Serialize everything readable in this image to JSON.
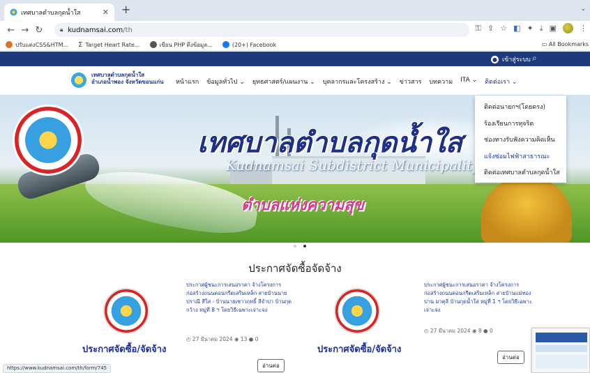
{
  "browser": {
    "tab_title": "เทศบาลตำบลกุดน้ำใส",
    "url_domain": "kudnamsai.com",
    "url_path": "/th",
    "bookmarks": [
      {
        "label": "ปรับแต่งCSS&HTM...",
        "color": "#e0702a"
      },
      {
        "label": "Target Heart Rate...",
        "color": "#444444"
      },
      {
        "label": "เขียน PHP ดึงข้อมูล...",
        "color": "#555555"
      },
      {
        "label": "(20+) Facebook",
        "color": "#1877f2"
      }
    ],
    "all_bookmarks": "All Bookmarks",
    "status_url": "https://www.kudnamsai.com/th/form/745"
  },
  "topbar": {
    "login": "เข้าสู่ระบบ"
  },
  "brand": {
    "line1": "เทศบาลตำบลกุดน้ำใส",
    "line2": "อำเภอน้ำพอง จังหวัดขอนแก่น"
  },
  "menu": [
    {
      "label": "หน้าแรก",
      "active": false
    },
    {
      "label": "ข้อมูลทั่วไป ⌄",
      "active": false
    },
    {
      "label": "ยุทธศาสตร์/แผนงาน ⌄",
      "active": false
    },
    {
      "label": "บุคลากรและโครงสร้าง ⌄",
      "active": false
    },
    {
      "label": "ข่าวสาร",
      "active": false
    },
    {
      "label": "บทความ",
      "active": false
    },
    {
      "label": "ITA ⌄",
      "active": false
    },
    {
      "label": "ติดต่อเรา ⌄",
      "active": true
    }
  ],
  "dropdown": [
    {
      "label": "ติดต่อนายกฯ(โดยตรง)",
      "highlight": false
    },
    {
      "label": "ร้องเรียนการทุจริต",
      "highlight": false
    },
    {
      "label": "ช่องทางรับฟังความคิดเห็น",
      "highlight": false
    },
    {
      "label": "แจ้งซ่อมไฟฟ้าสาธารณะ",
      "highlight": true
    },
    {
      "label": "ติดต่อเทศบาลตำบลกุดน้ำใส",
      "highlight": false
    }
  ],
  "hero": {
    "title": "เทศบาลตำบลกุดน้ำใส",
    "subtitle": "Kudnamsai Subdistrict Municipality",
    "slogan": "ตำบลแห่งความสุข"
  },
  "section_title": "ประกาศจัดซื้อจัดจ้าง",
  "cards": [
    {
      "caption": "ประกาศจัดซื้อ/จัดจ้าง",
      "text": "ประกาศผู้ชนะการเสนอราคา จ้างโครงการก่อสร้างถนนคอนกรีตเสริมเหล็ก สายบ้านนายปราณี สีใส - บ้านนายเชาวฤทธิ์ สีจำปา บ้านกุดกว้าง หมู่ที่ 8 ฯ โดยวิธีเฉพาะเจาะจง",
      "meta": "◴ 27 มีนาคม 2024 ◉ 13 ● 0",
      "readmore": "อ่านต่อ"
    },
    {
      "caption": "ประกาศจัดซื้อ/จัดจ้าง",
      "text": "ประกาศผู้ชนะการเสนอราคา จ้างโครงการก่อสร้างถนนคอนกรีตเสริมเหล็ก สายบ้านแม่ทองปาน มาตุลี บ้านกุดน้ำใส หมู่ที่ 1 ฯ โดยวิธีเฉพาะเจาะจง",
      "meta": "◴ 27 มีนาคม 2024 ◉ 8 ● 0",
      "readmore": "อ่านต่อ"
    }
  ]
}
